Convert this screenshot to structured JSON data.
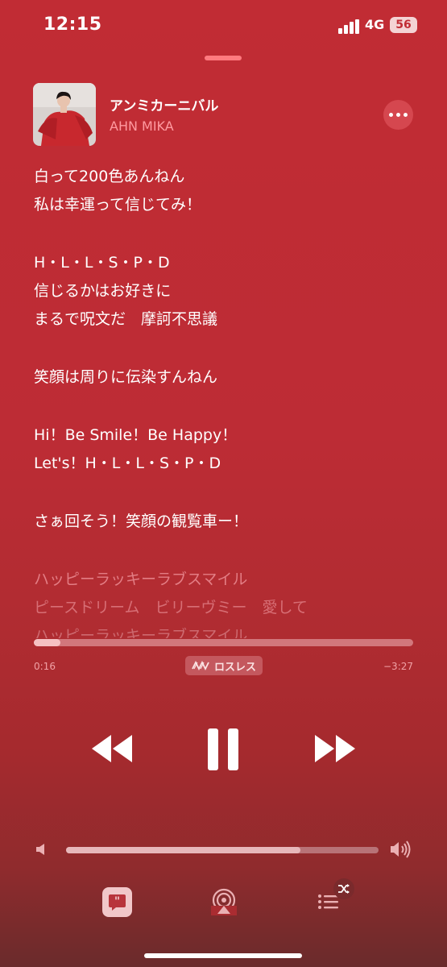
{
  "status_bar": {
    "time": "12:15",
    "network": "4G",
    "battery": "56"
  },
  "track": {
    "title": "アンミカーニバル",
    "artist": "AHN MIKA"
  },
  "lyrics": {
    "lines": [
      "白って200色あんねん",
      "私は幸運って信じてみ！",
      "",
      "H・L・L・S・P・D",
      "信じるかはお好きに",
      "まるで呪文だ　摩訶不思議",
      "",
      "笑顔は周りに伝染すんねん",
      "",
      "Hi！Be Smile！Be Happy！",
      "Let's！H・L・L・S・P・D",
      "",
      "さぁ回そう！笑顔の観覧車ー！",
      "",
      "ハッピーラッキーラブスマイル",
      "ピースドリーム　ビリーヴミー　愛して",
      "ハッピーラッキーラブスマイル"
    ]
  },
  "playback": {
    "elapsed": "0:16",
    "remaining": "−3:27",
    "progress_fraction": 0.07,
    "quality_label": "ロスレス",
    "volume_fraction": 0.75
  },
  "icons": {
    "more": "ellipsis-icon",
    "rewind": "rewind-icon",
    "pause": "pause-icon",
    "forward": "fast-forward-icon",
    "lyrics": "lyrics-quote-icon",
    "airplay": "airplay-icon",
    "queue": "queue-list-icon",
    "shuffle": "shuffle-icon"
  },
  "colors": {
    "background": "#c12c34",
    "accent": "#ff9aa0"
  }
}
